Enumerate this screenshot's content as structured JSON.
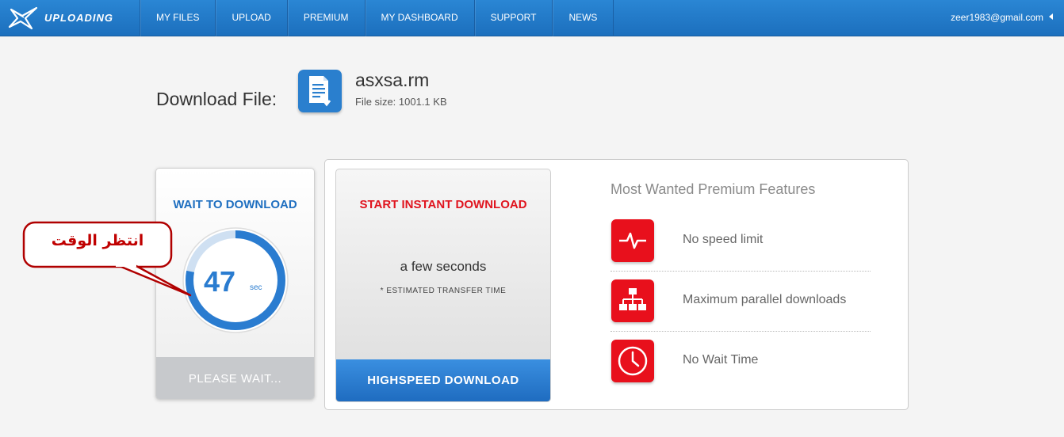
{
  "nav": {
    "logo_text": "UPLOADING",
    "items": [
      "MY FILES",
      "UPLOAD",
      "PREMIUM",
      "MY DASHBOARD",
      "SUPPORT",
      "NEWS"
    ],
    "user_email": "zeer1983@gmail.com"
  },
  "file": {
    "heading": "Download File:",
    "name": "asxsa.rm",
    "size": "File size: 1001.1 KB"
  },
  "wait": {
    "title": "WAIT TO DOWNLOAD",
    "countdown": "47",
    "unit": "sec",
    "button": "PLEASE WAIT...",
    "progress_fraction": 0.78
  },
  "callout": {
    "text": "انتظر الوقت"
  },
  "instant": {
    "title": "START INSTANT DOWNLOAD",
    "time": "a few seconds",
    "note": "* ESTIMATED TRANSFER TIME",
    "button": "HIGHSPEED DOWNLOAD"
  },
  "features": {
    "title": "Most Wanted Premium Features",
    "items": [
      {
        "label": "No speed limit",
        "icon": "pulse-icon"
      },
      {
        "label": "Maximum parallel downloads",
        "icon": "network-icon"
      },
      {
        "label": "No Wait Time",
        "icon": "clock-icon"
      }
    ]
  },
  "colors": {
    "nav": "#1f74c4",
    "accent_blue": "#2a7cd0",
    "accent_red": "#e8101c"
  }
}
